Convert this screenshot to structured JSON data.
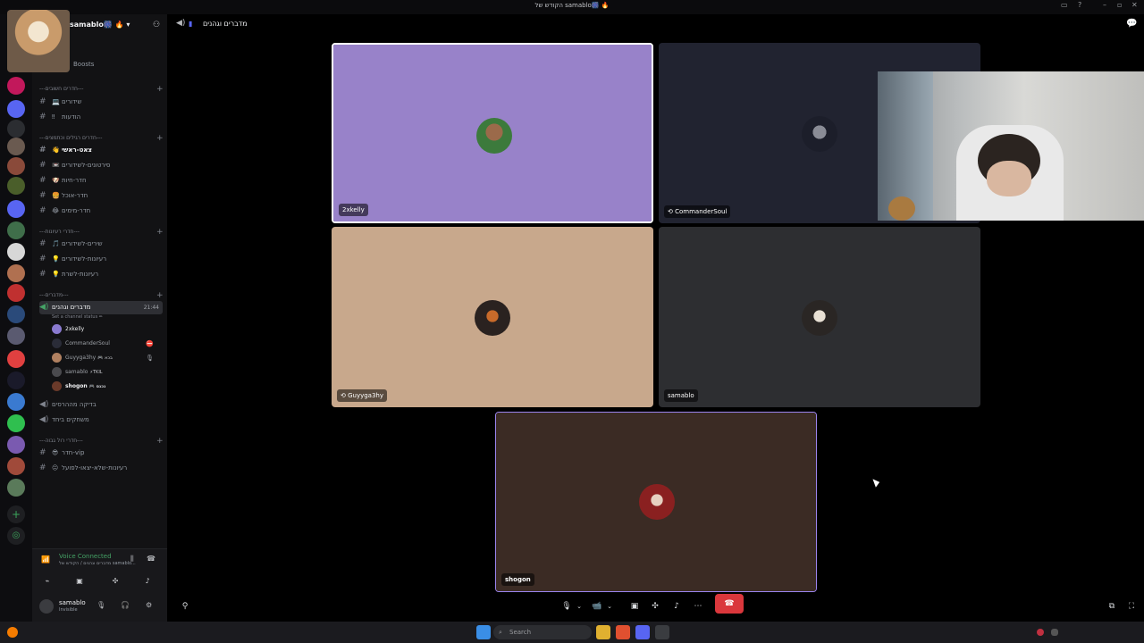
{
  "window": {
    "title": "הקודש של samablo🎆 🔥"
  },
  "server": {
    "name": "samablo🎆 🔥",
    "boosts_label": "Boosts"
  },
  "categories": [
    {
      "label": "---חדרים חשובים---"
    },
    {
      "label": "---חדרים רגילים וכתמצים---"
    },
    {
      "label": "---חדרי רעיונות---"
    },
    {
      "label": "---מדברים---"
    },
    {
      "label": "---חדרי רול גבוה---"
    }
  ],
  "channels": {
    "c1": "שידורים",
    "c2": "הודעות",
    "c3": "צאט-ראשי",
    "c4": "סירטונים-לשידורים",
    "c5": "חדר-חיות",
    "c6": "חדר-אוכל",
    "c7": "חדר-מימים",
    "c8": "שירים-לשידורים",
    "c9": "רעיונות-לשידורים",
    "c10": "רעיונות-לשרת",
    "voice_active": "מדברים וגהנים",
    "voice_time": "21:44",
    "voice_sub": "Set a channel status ✏",
    "v2": "בדיקה מההרסים",
    "v3": "משחקים ביחד",
    "c11": "חדר-vip",
    "c12": "רעיונות-שלא-יצאו-לפועל"
  },
  "voice_users": [
    {
      "name": "2xkelly",
      "tag": ""
    },
    {
      "name": "CommanderSoul",
      "tag": ""
    },
    {
      "name": "Guyyga3hy",
      "tag": "🎮 בכא"
    },
    {
      "name": "samablo",
      "tag": "⚡TKIL"
    },
    {
      "name": "shogon",
      "tag": "🎮 נכנס"
    }
  ],
  "voice_panel": {
    "status": "Voice Connected",
    "channel": "מדברים וגהנים / הקודש של samablo...",
    "username": "samablo",
    "user_status": "Invisible"
  },
  "stage": {
    "channel_name": "מדברים וגהנים"
  },
  "tiles": [
    {
      "name": "2xkelly",
      "bg": "#9882c9"
    },
    {
      "name": "CommanderSoul",
      "bg": "#212330"
    },
    {
      "name": "Guyyga3hy",
      "bg": "#c8a88c"
    },
    {
      "name": "samablo",
      "bg": "#2d2e31"
    },
    {
      "name": "shogon",
      "bg": "#3b2b24"
    }
  ],
  "taskbar": {
    "search_placeholder": "Search"
  },
  "colors": {
    "accent_green": "#45a366",
    "end_call": "#da373c",
    "speaking_outline": "#9b84ee"
  }
}
